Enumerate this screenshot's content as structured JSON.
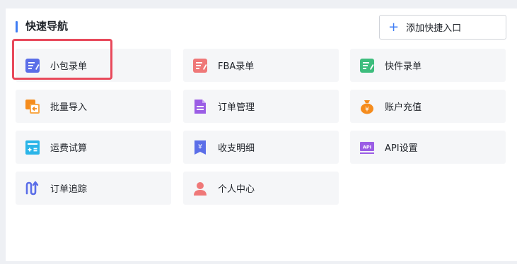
{
  "header": {
    "title": "快速导航",
    "add_button_label": "添加快捷入口"
  },
  "tiles": [
    {
      "label": "小包录单",
      "icon": "edit-doc-icon",
      "color": "#5b6ee8"
    },
    {
      "label": "FBA录单",
      "icon": "edit-doc-icon",
      "color": "#ef7878"
    },
    {
      "label": "快件录单",
      "icon": "edit-doc-icon",
      "color": "#3dbd7d"
    },
    {
      "label": "批量导入",
      "icon": "import-icon",
      "color": "#f58c1d"
    },
    {
      "label": "订单管理",
      "icon": "file-icon",
      "color": "#9b5de5"
    },
    {
      "label": "账户充值",
      "icon": "money-bag-icon",
      "color": "#f58c1d"
    },
    {
      "label": "运费试算",
      "icon": "calculator-icon",
      "color": "#2bb5e8"
    },
    {
      "label": "收支明细",
      "icon": "receipt-icon",
      "color": "#5b6ee8"
    },
    {
      "label": "API设置",
      "icon": "api-icon",
      "color": "#9b5de5"
    },
    {
      "label": "订单追踪",
      "icon": "route-icon",
      "color": "#5b6ee8"
    },
    {
      "label": "个人中心",
      "icon": "user-icon",
      "color": "#ef7878"
    }
  ]
}
